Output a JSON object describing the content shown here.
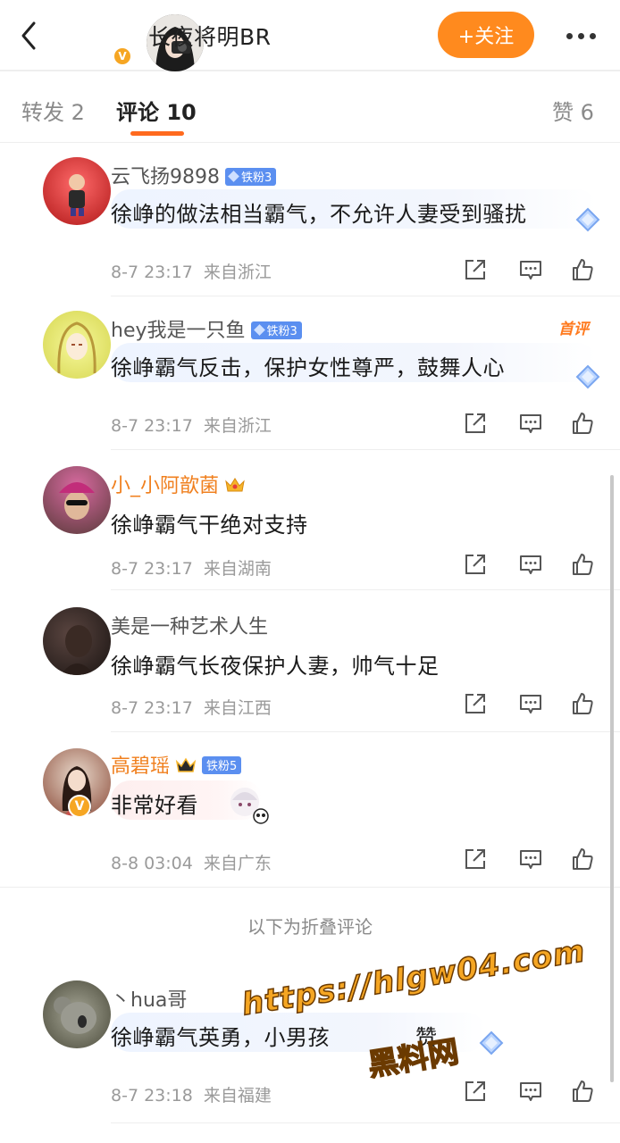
{
  "header": {
    "user_name": "长夜将明BR",
    "follow_label": "+关注",
    "verified_mark": "V"
  },
  "tabs": [
    {
      "label": "转发 2",
      "active": false
    },
    {
      "label": "评论 10",
      "active": true
    },
    {
      "label": "赞 6",
      "active": false
    }
  ],
  "comments": [
    {
      "name": "云飞扬9898",
      "badge": "铁粉3",
      "text": "徐峥的做法相当霸气，不允许人妻受到骚扰",
      "time": "8-7 23:17",
      "location": "来自浙江",
      "avatar_colors": [
        "#e8282e",
        "#c41c1c"
      ]
    },
    {
      "name": "hey我是一只鱼",
      "badge": "铁粉3",
      "text": "徐峥霸气反击，保护女性尊严，鼓舞人心",
      "time": "8-7 23:17",
      "location": "来自浙江",
      "tag": "首评",
      "avatar_colors": [
        "#eef27a",
        "#d9d84a"
      ]
    },
    {
      "name": "小_小阿歆菌",
      "text": "徐峥霸气干绝对支持",
      "time": "8-7 23:17",
      "location": "来自湖南",
      "avatar_colors": [
        "#c44d8a",
        "#6b4a3a"
      ]
    },
    {
      "name": "美是一种艺术人生",
      "text": "徐峥霸气长夜保护人妻，帅气十足",
      "time": "8-7 23:17",
      "location": "来自江西",
      "avatar_colors": [
        "#3a2b28",
        "#1f1a18"
      ]
    },
    {
      "name": "高碧瑶",
      "badge": "铁粉5",
      "text": "非常好看",
      "time": "8-8 03:04",
      "location": "来自广东",
      "avatar_colors": [
        "#d9c4b4",
        "#7a3a2a"
      ]
    }
  ],
  "folded_label": "以下为折叠评论",
  "folded_comments": [
    {
      "name": "丶hua哥",
      "text": "徐峥霸气英勇，小男孩",
      "text_tail": "赞",
      "time": "8-7 23:18",
      "location": "来自福建",
      "avatar_colors": [
        "#8a8a7a",
        "#5a5a4a"
      ]
    }
  ],
  "watermark": {
    "url": "https://hlgw04.com",
    "cn": "黑料网"
  },
  "colors": {
    "accent": "#ff8a1e",
    "tab_underline": "#ff6a1e",
    "vip_name": "#f0801f",
    "fan_badge": "#5b8ff0"
  }
}
